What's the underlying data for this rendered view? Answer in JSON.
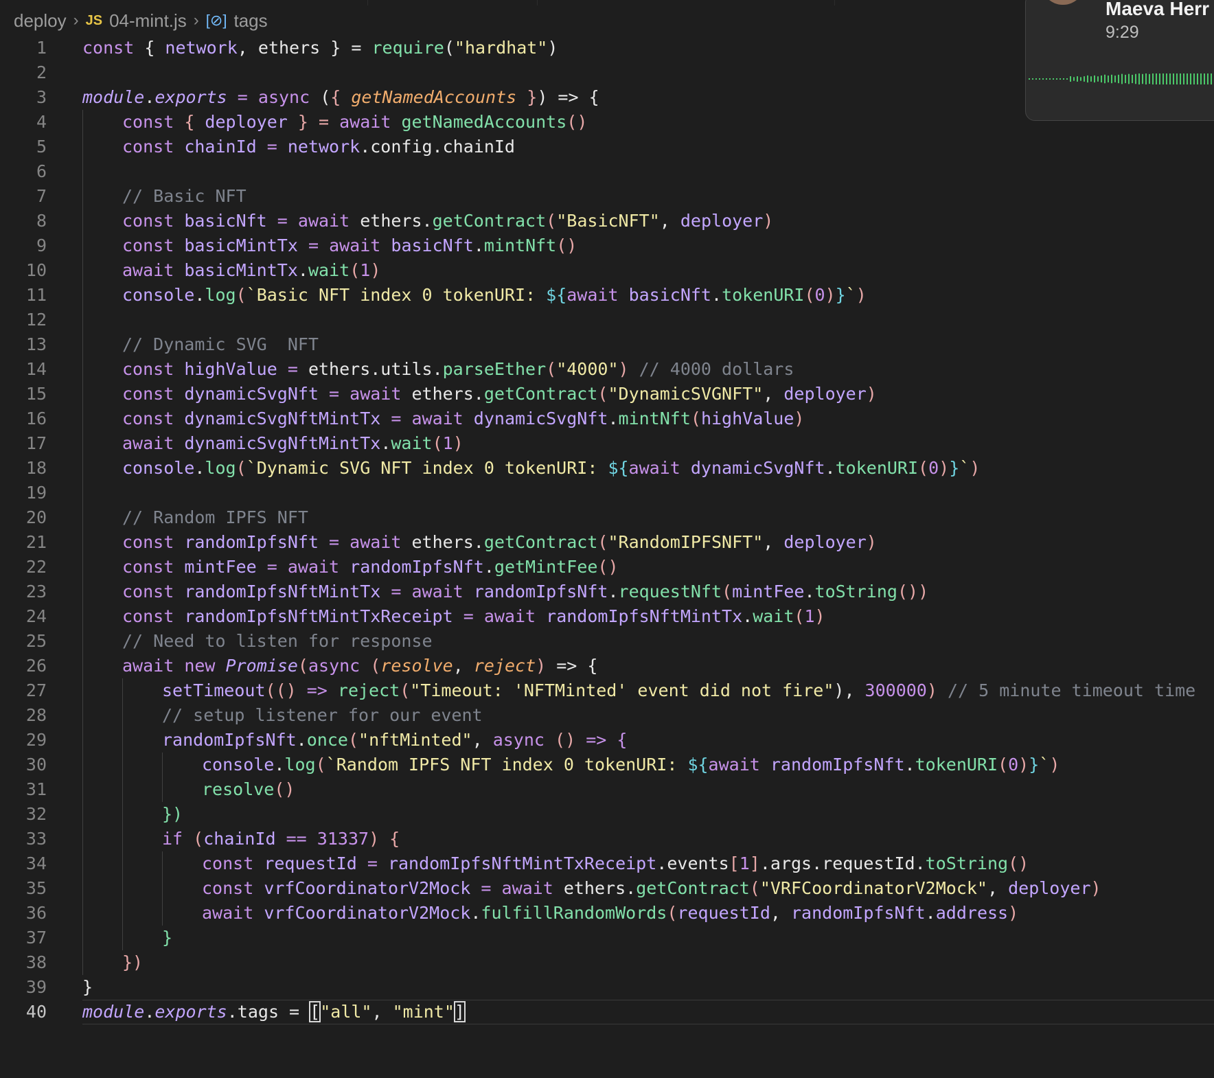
{
  "breadcrumb": {
    "folder": "deploy",
    "file_icon": "JS",
    "file": "04-mint.js",
    "symbol": "tags"
  },
  "notification": {
    "name": "Maeva Herr",
    "time": "9:29"
  },
  "line_numbers": [
    "1",
    "2",
    "3",
    "4",
    "5",
    "6",
    "7",
    "8",
    "9",
    "10",
    "11",
    "12",
    "13",
    "14",
    "15",
    "16",
    "17",
    "18",
    "19",
    "20",
    "21",
    "22",
    "23",
    "24",
    "25",
    "26",
    "27",
    "28",
    "29",
    "30",
    "31",
    "32",
    "33",
    "34",
    "35",
    "36",
    "37",
    "38",
    "39",
    "40"
  ],
  "code": {
    "l1": [
      "const",
      " { ",
      "network",
      ", ",
      "ethers",
      " } = ",
      "require",
      "(",
      "\"hardhat\"",
      ")"
    ],
    "l3": [
      "module",
      ".",
      "exports",
      " = ",
      "async",
      " (",
      "{ ",
      "getNamedAccounts",
      " }",
      ")",
      " => {"
    ],
    "l4": [
      "const",
      " { ",
      "deployer",
      " } = ",
      "await",
      " ",
      "getNamedAccounts",
      "()"
    ],
    "l5": [
      "const",
      " ",
      "chainId",
      " = ",
      "network",
      ".config.chainId"
    ],
    "l7": [
      "// Basic NFT"
    ],
    "l8": [
      "const",
      " ",
      "basicNft",
      " = ",
      "await",
      " ethers.",
      "getContract",
      "(",
      "\"BasicNFT\"",
      ", ",
      "deployer",
      ")"
    ],
    "l9": [
      "const",
      " ",
      "basicMintTx",
      " = ",
      "await",
      " ",
      "basicNft",
      ".",
      "mintNft",
      "()"
    ],
    "l10": [
      "await",
      " ",
      "basicMintTx",
      ".",
      "wait",
      "(",
      "1",
      ")"
    ],
    "l11": [
      "console",
      ".",
      "log",
      "(",
      "`Basic NFT index 0 tokenURI: ",
      "${",
      "await",
      " ",
      "basicNft",
      ".",
      "tokenURI",
      "(",
      "0",
      ")",
      "}",
      "`",
      ")"
    ],
    "l13": [
      "// Dynamic SVG  NFT"
    ],
    "l14": [
      "const",
      " ",
      "highValue",
      " = ",
      "ethers.utils.",
      "parseEther",
      "(",
      "\"4000\"",
      ")",
      " // 4000 dollars"
    ],
    "l15": [
      "const",
      " ",
      "dynamicSvgNft",
      " = ",
      "await",
      " ethers.",
      "getContract",
      "(",
      "\"DynamicSVGNFT\"",
      ", ",
      "deployer",
      ")"
    ],
    "l16": [
      "const",
      " ",
      "dynamicSvgNftMintTx",
      " = ",
      "await",
      " ",
      "dynamicSvgNft",
      ".",
      "mintNft",
      "(",
      "highValue",
      ")"
    ],
    "l17": [
      "await",
      " ",
      "dynamicSvgNftMintTx",
      ".",
      "wait",
      "(",
      "1",
      ")"
    ],
    "l18": [
      "console",
      ".",
      "log",
      "(",
      "`Dynamic SVG NFT index 0 tokenURI: ",
      "${",
      "await",
      " ",
      "dynamicSvgNft",
      ".",
      "tokenURI",
      "(",
      "0",
      ")",
      "}",
      "`",
      ")"
    ],
    "l20": [
      "// Random IPFS NFT"
    ],
    "l21": [
      "const",
      " ",
      "randomIpfsNft",
      " = ",
      "await",
      " ethers.",
      "getContract",
      "(",
      "\"RandomIPFSNFT\"",
      ", ",
      "deployer",
      ")"
    ],
    "l22": [
      "const",
      " ",
      "mintFee",
      " = ",
      "await",
      " ",
      "randomIpfsNft",
      ".",
      "getMintFee",
      "()"
    ],
    "l23": [
      "const",
      " ",
      "randomIpfsNftMintTx",
      " = ",
      "await",
      " ",
      "randomIpfsNft",
      ".",
      "requestNft",
      "(",
      "mintFee",
      ".",
      "toString",
      "()",
      ")"
    ],
    "l24": [
      "const",
      " ",
      "randomIpfsNftMintTxReceipt",
      " = ",
      "await",
      " ",
      "randomIpfsNftMintTx",
      ".",
      "wait",
      "(",
      "1",
      ")"
    ],
    "l25": [
      "// Need to listen for response"
    ],
    "l26": [
      "await",
      " ",
      "new",
      " ",
      "Promise",
      "(",
      "async",
      " (",
      "resolve",
      ", ",
      "reject",
      ")",
      " => {"
    ],
    "l27": [
      "setTimeout",
      "(",
      "()",
      " => ",
      "reject",
      "(",
      "\"Timeout: 'NFTMinted' event did not fire\"",
      "), ",
      "300000",
      ")",
      " // 5 minute timeout time"
    ],
    "l28": [
      "// setup listener for our event"
    ],
    "l29": [
      "randomIpfsNft",
      ".",
      "once",
      "(",
      "\"nftMinted\"",
      ", ",
      "async",
      " ",
      "()",
      " => {"
    ],
    "l30": [
      "console",
      ".",
      "log",
      "(",
      "`Random IPFS NFT index 0 tokenURI: ",
      "${",
      "await",
      " ",
      "randomIpfsNft",
      ".",
      "tokenURI",
      "(",
      "0",
      ")",
      "}",
      "`",
      ")"
    ],
    "l31": [
      "resolve",
      "()"
    ],
    "l32": [
      "})"
    ],
    "l33": [
      "if",
      " (",
      "chainId",
      " == ",
      "31337",
      ") {"
    ],
    "l34": [
      "const",
      " ",
      "requestId",
      " = ",
      "randomIpfsNftMintTxReceipt",
      ".events",
      "[",
      "1",
      "]",
      ".args.requestId.",
      "toString",
      "()"
    ],
    "l35": [
      "const",
      " ",
      "vrfCoordinatorV2Mock",
      " = ",
      "await",
      " ethers.",
      "getContract",
      "(",
      "\"VRFCoordinatorV2Mock\"",
      ", ",
      "deployer",
      ")"
    ],
    "l36": [
      "await",
      " ",
      "vrfCoordinatorV2Mock",
      ".",
      "fulfillRandomWords",
      "(",
      "requestId",
      ", ",
      "randomIpfsNft",
      ".",
      "address",
      ")"
    ],
    "l37": [
      "}"
    ],
    "l38": [
      "})"
    ],
    "l39": [
      "}"
    ],
    "l40": [
      "module",
      ".",
      "exports",
      ".tags = ",
      "[",
      "\"all\"",
      ", ",
      "\"mint\"",
      "]"
    ]
  },
  "colors": {
    "background": "#1e1e1e",
    "keyword": "#c792ea",
    "variable": "#c3a6ff",
    "function": "#82e0aa",
    "string": "#f0e9a6",
    "comment": "#7f848e",
    "waveform": "#4cc96a"
  },
  "icons": {
    "file_icon": "javascript-file-icon",
    "symbol_icon": "symbol-variable-icon",
    "chevron": "chevron-right-icon"
  }
}
